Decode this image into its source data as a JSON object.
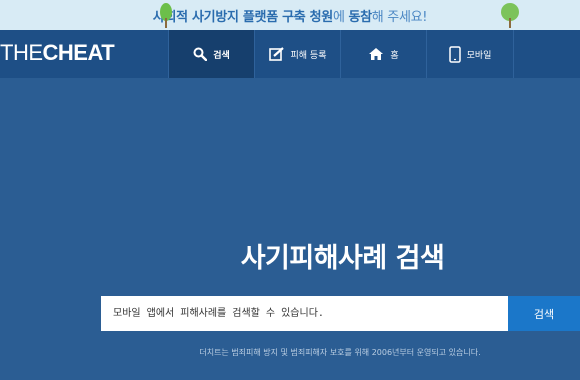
{
  "banner": {
    "part1": "사회적 사기방지 플랫폼 구축 청원",
    "part2": "에 ",
    "part3": "동참",
    "part4": "해 주세요!"
  },
  "logo": {
    "prefix": "THE",
    "suffix": "CHEAT"
  },
  "nav": {
    "search": "검색",
    "report": "피해 등록",
    "home": "홈",
    "mobile": "모바일"
  },
  "hero": {
    "title": "사기피해사례 검색",
    "search_placeholder": "모바일 앱에서 피해사례를 검색할 수 있습니다.",
    "search_button": "검색",
    "footnote": "더치트는 범죄피해 방지 및 범죄피해자 보호를 위해 2006년부터 운영되고 있습니다."
  },
  "colors": {
    "background": "#2b5d93",
    "navbar": "#1e4f86",
    "banner": "#d8ebf5",
    "accent": "#1b77c9"
  }
}
